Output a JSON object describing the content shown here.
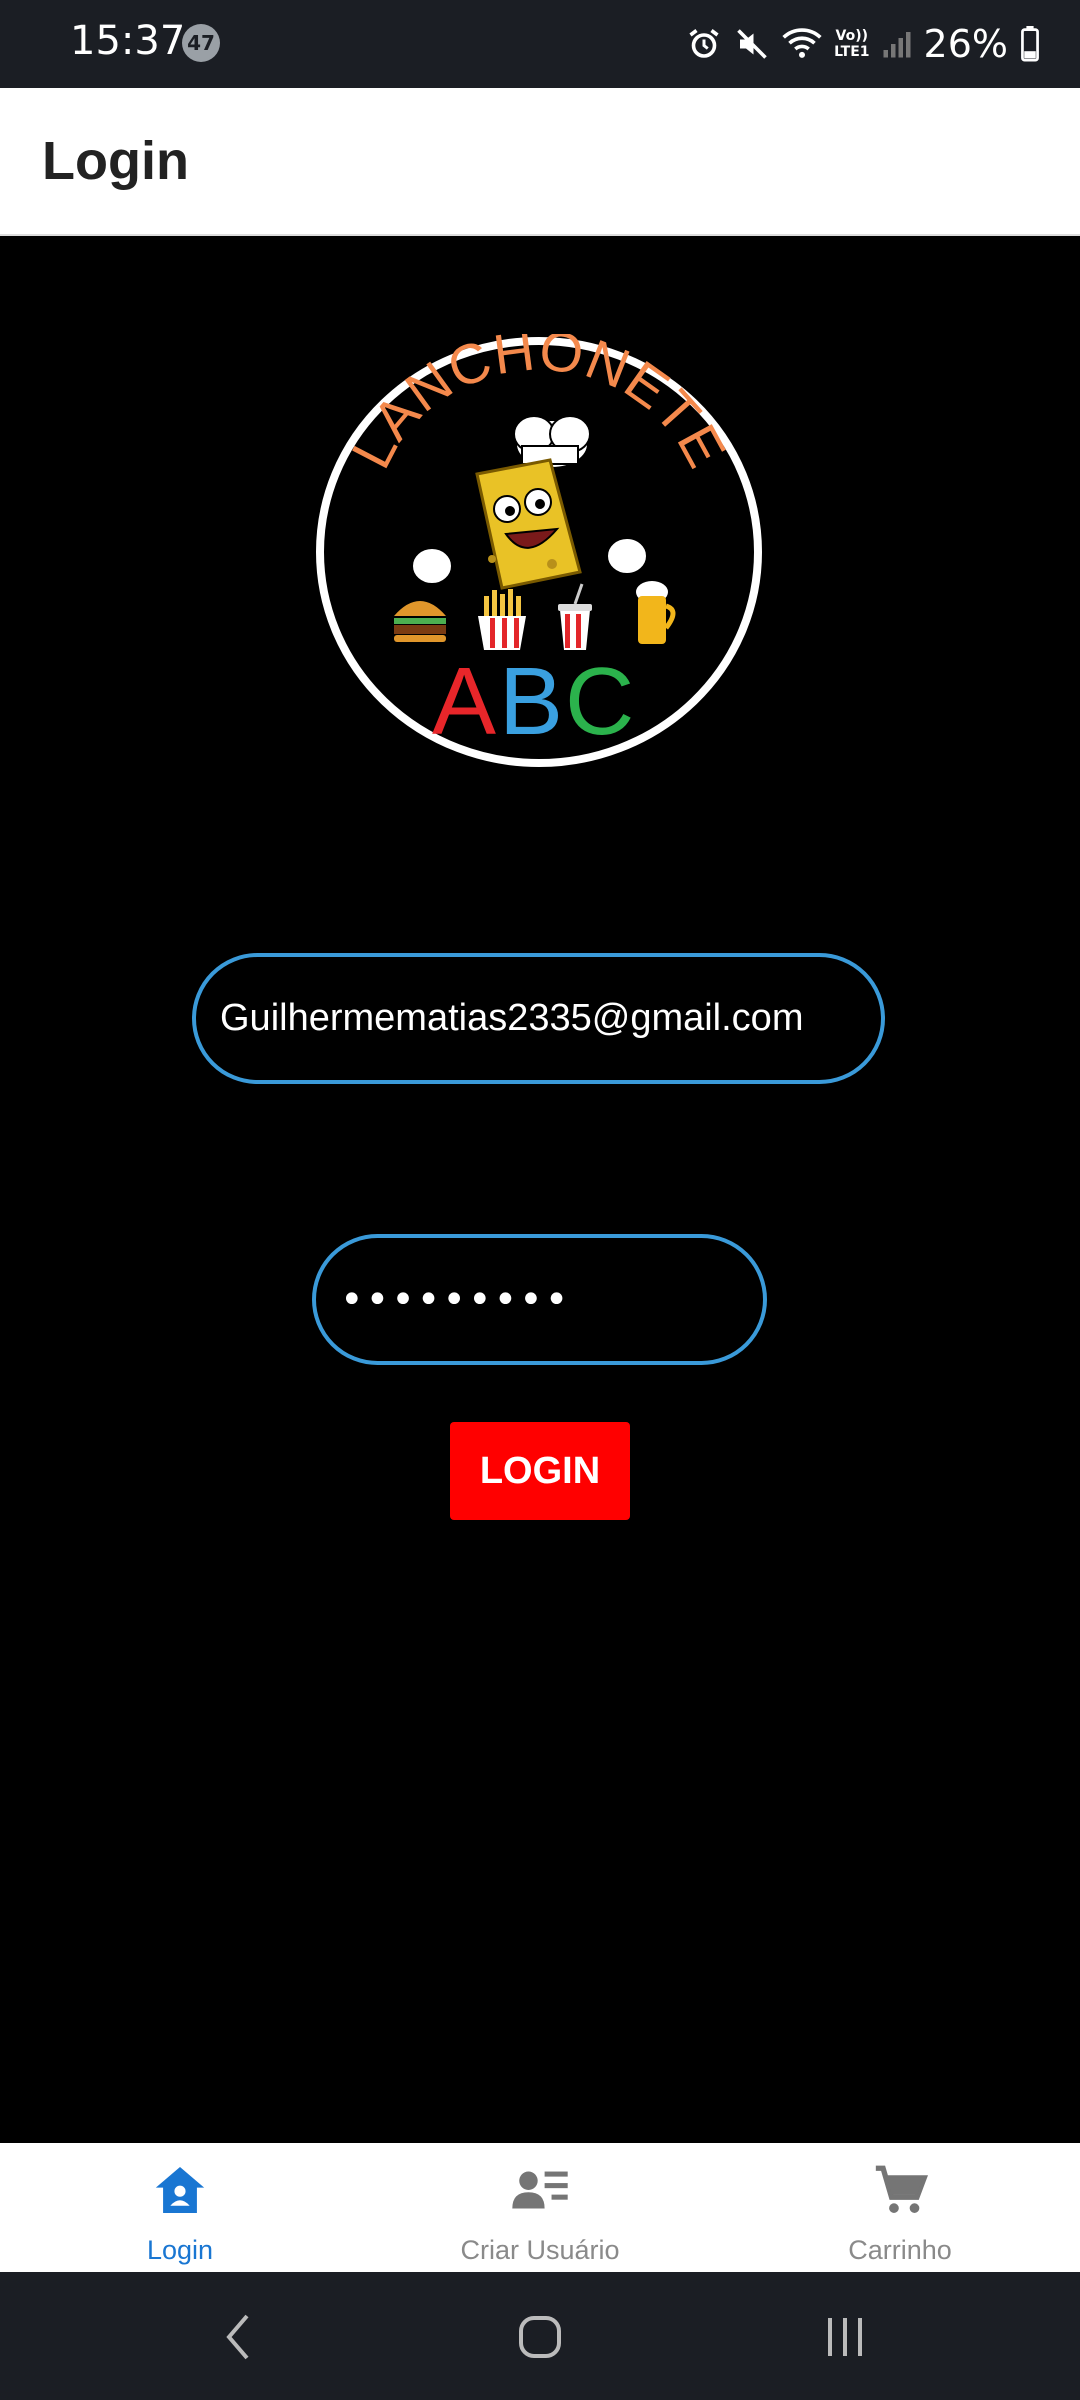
{
  "status_bar": {
    "time": "15:37",
    "notification_count": "47",
    "battery_percent": "26%",
    "network_label_top": "Vo))",
    "network_label_bottom": "LTE1"
  },
  "header": {
    "title": "Login"
  },
  "logo": {
    "arc_text": "LANCHONETE",
    "abc_a": "A",
    "abc_b": "B",
    "abc_c": "C"
  },
  "form": {
    "email_value": "Guilhermematias2335@gmail.com",
    "password_value": "•••••••••",
    "login_button_label": "LOGIN"
  },
  "bottom_nav": {
    "items": [
      {
        "label": "Login",
        "icon": "home-icon",
        "active": true
      },
      {
        "label": "Criar Usuário",
        "icon": "user-list-icon",
        "active": false
      },
      {
        "label": "Carrinho",
        "icon": "cart-icon",
        "active": false
      }
    ]
  },
  "colors": {
    "accent": "#1976d2",
    "field_border": "#3a9ad9",
    "button": "#ff0000",
    "logo_arc_text": "#f4894c",
    "abc_a": "#e8262a",
    "abc_b": "#3aa0e0",
    "abc_c": "#2bb24c"
  }
}
